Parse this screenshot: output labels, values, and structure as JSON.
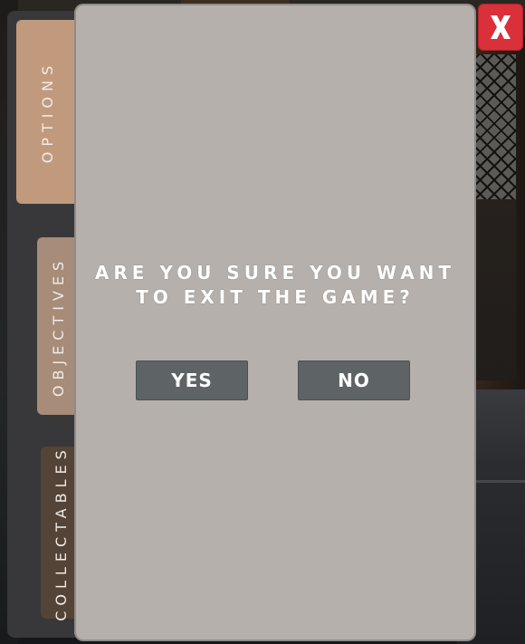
{
  "tabs": [
    {
      "label": "OPTIONS",
      "color": "#c19a7e"
    },
    {
      "label": "OBJECTIVES",
      "color": "#a68c79"
    },
    {
      "label": "COLLECTABLES",
      "color": "#544337"
    }
  ],
  "dialog": {
    "question_line1": "ARE YOU SURE YOU WANT",
    "question_line2": "TO EXIT THE GAME?",
    "yes_label": "YES",
    "no_label": "NO"
  },
  "close": {
    "icon": "close-x-icon",
    "color": "#d9303a"
  }
}
